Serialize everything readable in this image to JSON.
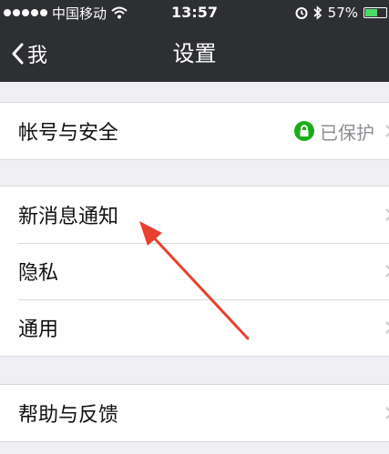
{
  "status_bar": {
    "carrier": "中国移动",
    "time": "13:57",
    "battery": "57%",
    "battery_level": 0.57,
    "icons": [
      "signal-dots",
      "wifi-icon",
      "alarm-icon",
      "bluetooth-icon",
      "battery-icon"
    ]
  },
  "nav": {
    "back_label": "我",
    "title": "设置"
  },
  "groups": [
    {
      "items": [
        {
          "label": "帐号与安全",
          "value": "已保护",
          "icon": "lock-icon"
        }
      ]
    },
    {
      "items": [
        {
          "label": "新消息通知"
        },
        {
          "label": "隐私"
        },
        {
          "label": "通用"
        }
      ]
    },
    {
      "items": [
        {
          "label": "帮助与反馈"
        }
      ]
    }
  ],
  "colors": {
    "nav_background": "#2e2f33",
    "page_background": "#efeff4",
    "protected_badge": "#1aad19",
    "annotation_arrow": "#e8412f"
  }
}
